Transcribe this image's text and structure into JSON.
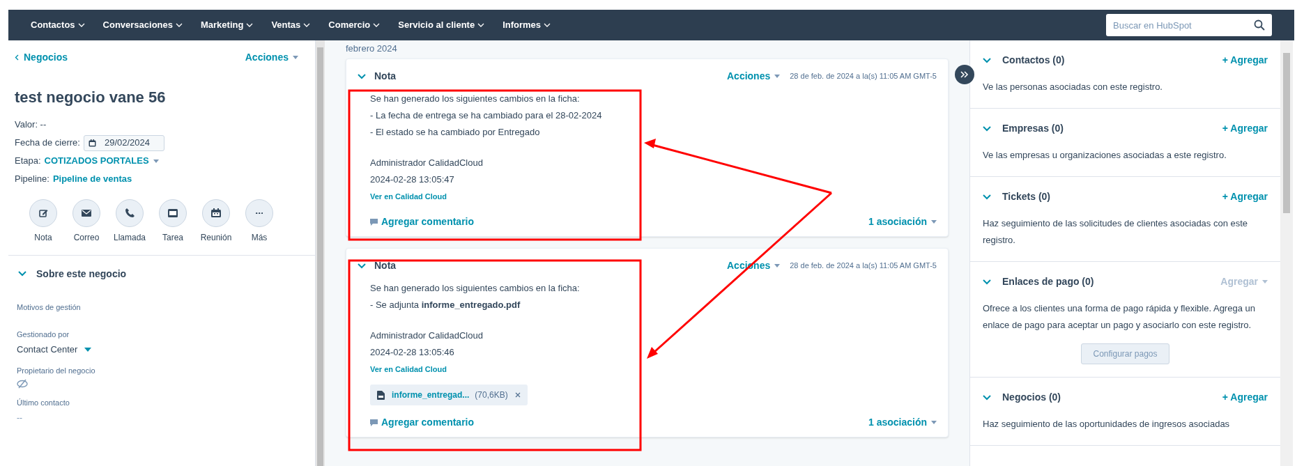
{
  "nav": {
    "items": [
      {
        "label": "Contactos"
      },
      {
        "label": "Conversaciones"
      },
      {
        "label": "Marketing"
      },
      {
        "label": "Ventas"
      },
      {
        "label": "Comercio"
      },
      {
        "label": "Servicio al cliente"
      },
      {
        "label": "Informes"
      }
    ],
    "search": {
      "placeholder": "Buscar en HubSpot"
    }
  },
  "record": {
    "back": "Negocios",
    "actions": "Acciones",
    "title": "test negocio vane 56",
    "fields": [
      {
        "kind": "text",
        "text": "Valor: --"
      },
      {
        "kind": "date",
        "label": "Fecha de cierre:",
        "value": "29/02/2024"
      },
      {
        "kind": "dropdown",
        "label": "Etapa:",
        "value": "COTIZADOS PORTALES"
      },
      {
        "kind": "link",
        "label": "Pipeline:",
        "value": "Pipeline de ventas"
      }
    ],
    "activities": [
      {
        "kind": "note",
        "label": "Nota"
      },
      {
        "kind": "email",
        "label": "Correo"
      },
      {
        "kind": "call",
        "label": "Llamada"
      },
      {
        "kind": "task",
        "label": "Tarea"
      },
      {
        "kind": "meeting",
        "label": "Reunión"
      },
      {
        "kind": "more",
        "label": "Más"
      }
    ],
    "about": {
      "title": "Sobre este negocio",
      "expanded": true,
      "properties": [
        {
          "kind": "empty",
          "label": "Motivos de gestión"
        },
        {
          "kind": "dropdown",
          "label": "Gestionado por",
          "value": "Contact Center"
        },
        {
          "kind": "hidden",
          "label": "Propietario del negocio"
        },
        {
          "kind": "text",
          "label": "Último contacto",
          "value": "--"
        }
      ]
    }
  },
  "timeline": {
    "month": "febrero 2024",
    "notes": [
      {
        "title": "Nota",
        "expanded": true,
        "actions": "Acciones",
        "timestamp": "28 de feb. de 2024 a la(s) 11:05 AM GMT-5",
        "lines": [
          "Se han generado los siguientes cambios en la ficha:",
          "- La fecha de entrega se ha cambiado para el 28-02-2024",
          "- El estado se ha cambiado por Entregado"
        ],
        "author": "Administrador CalidadCloud",
        "datetime": "2024-02-28 13:05:47",
        "link": "Ver en Calidad Cloud",
        "comment": "Agregar comentario",
        "associations": "1 asociación"
      },
      {
        "title": "Nota",
        "expanded": true,
        "actions": "Acciones",
        "timestamp": "28 de feb. de 2024 a la(s) 11:05 AM GMT-5",
        "lines": [
          "Se han generado los siguientes cambios en la ficha:",
          "- Se adjunta **informe_entregado.pdf**"
        ],
        "author": "Administrador CalidadCloud",
        "datetime": "2024-02-28 13:05:46",
        "link": "Ver en Calidad Cloud",
        "attachment": {
          "name": "informe_entregad...",
          "size": "(70,6KB)"
        },
        "comment": "Agregar comentario",
        "associations": "1 asociación"
      }
    ]
  },
  "sidebar": {
    "cards": [
      {
        "title": "Contactos (0)",
        "expanded": true,
        "add": "+ Agregar",
        "add_disabled": false,
        "description": "Ve las personas asociadas con este registro."
      },
      {
        "title": "Empresas (0)",
        "expanded": true,
        "add": "+ Agregar",
        "add_disabled": false,
        "description": "Ve las empresas u organizaciones asociadas a este registro."
      },
      {
        "title": "Tickets (0)",
        "expanded": true,
        "add": "+ Agregar",
        "add_disabled": false,
        "description": "Haz seguimiento de las solicitudes de clientes asociadas con este registro."
      },
      {
        "title": "Enlaces de pago (0)",
        "expanded": true,
        "add": "Agregar",
        "add_disabled": true,
        "description": "Ofrece a los clientes una forma de pago rápida y flexible. Agrega un enlace de pago para aceptar un pago y asociarlo con este registro.",
        "button": "Configurar pagos"
      },
      {
        "title": "Negocios (0)",
        "expanded": true,
        "add": "+ Agregar",
        "add_disabled": false,
        "description": "Haz seguimiento de las oportunidades de ingresos asociadas"
      }
    ]
  }
}
